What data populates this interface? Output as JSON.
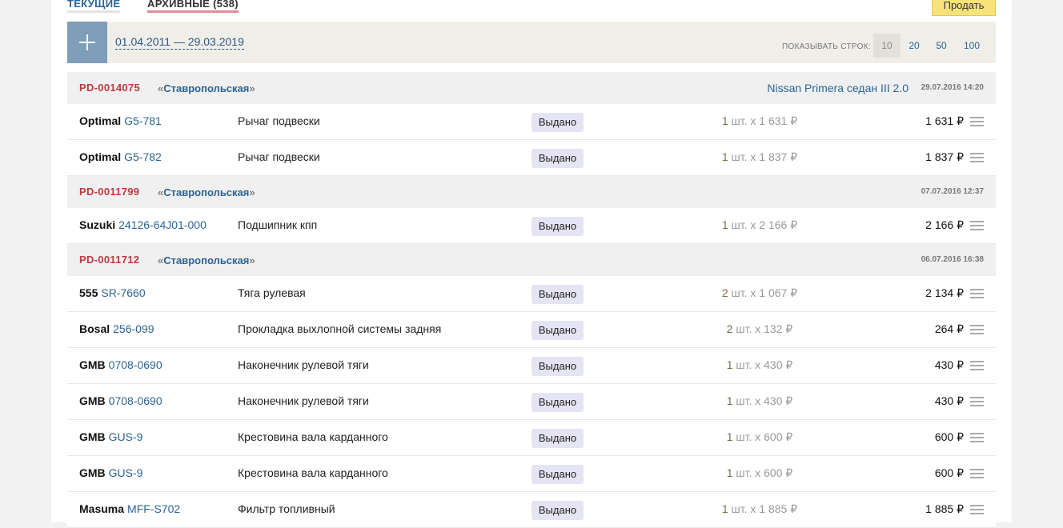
{
  "tabs": {
    "current": "ТЕКУЩИЕ",
    "archive": "АРХИВНЫЕ (538)"
  },
  "sell_button": "Продать",
  "filter": {
    "date_range": "01.04.2011 — 29.03.2019",
    "rows_label": "ПОКАЗЫВАТЬ СТРОК:",
    "rows_options": [
      "10",
      "20",
      "50",
      "100"
    ],
    "rows_selected": "10"
  },
  "orders": [
    {
      "number": "PD-0014075",
      "store_prefix": "«",
      "store": "Ставропольская",
      "store_suffix": "»",
      "car": "Nissan Primera седан III 2.0",
      "date": "29.07.2016 14:20",
      "items": [
        {
          "brand": "Optimal",
          "article": "G5-781",
          "name": "Рычаг подвески",
          "status": "Выдано",
          "qty": "1",
          "price": " шт. x 1 631 ₽",
          "total": "1 631 ₽"
        },
        {
          "brand": "Optimal",
          "article": "G5-782",
          "name": "Рычаг подвески",
          "status": "Выдано",
          "qty": "1",
          "price": " шт. x 1 837 ₽",
          "total": "1 837 ₽"
        }
      ]
    },
    {
      "number": "PD-0011799",
      "store_prefix": "«",
      "store": "Ставропольская",
      "store_suffix": "»",
      "car": "",
      "date": "07.07.2016 12:37",
      "items": [
        {
          "brand": "Suzuki",
          "article": "24126-64J01-000",
          "name": "Подшипник кпп",
          "status": "Выдано",
          "qty": "1",
          "price": " шт. x 2 166 ₽",
          "total": "2 166 ₽"
        }
      ]
    },
    {
      "number": "PD-0011712",
      "store_prefix": "«",
      "store": "Ставропольская",
      "store_suffix": "»",
      "car": "",
      "date": "06.07.2016 16:38",
      "items": [
        {
          "brand": "555",
          "article": "SR-7660",
          "name": "Тяга рулевая",
          "status": "Выдано",
          "qty": "2",
          "price": " шт. x 1 067 ₽",
          "total": "2 134 ₽"
        },
        {
          "brand": "Bosal",
          "article": "256-099",
          "name": "Прокладка выхлопной системы задняя",
          "status": "Выдано",
          "qty": "2",
          "price": " шт. x 132 ₽",
          "total": "264 ₽"
        },
        {
          "brand": "GMB",
          "article": "0708-0690",
          "name": "Наконечник рулевой тяги",
          "status": "Выдано",
          "qty": "1",
          "price": " шт. x 430 ₽",
          "total": "430 ₽"
        },
        {
          "brand": "GMB",
          "article": "0708-0690",
          "name": "Наконечник рулевой тяги",
          "status": "Выдано",
          "qty": "1",
          "price": " шт. x 430 ₽",
          "total": "430 ₽"
        },
        {
          "brand": "GMB",
          "article": "GUS-9",
          "name": "Крестовина вала карданного",
          "status": "Выдано",
          "qty": "1",
          "price": " шт. x 600 ₽",
          "total": "600 ₽"
        },
        {
          "brand": "GMB",
          "article": "GUS-9",
          "name": "Крестовина вала карданного",
          "status": "Выдано",
          "qty": "1",
          "price": " шт. x 600 ₽",
          "total": "600 ₽"
        },
        {
          "brand": "Masuma",
          "article": "MFF-S702",
          "name": "Фильтр топливный",
          "status": "Выдано",
          "qty": "1",
          "price": " шт. x 1 885 ₽",
          "total": "1 885 ₽"
        }
      ]
    }
  ]
}
